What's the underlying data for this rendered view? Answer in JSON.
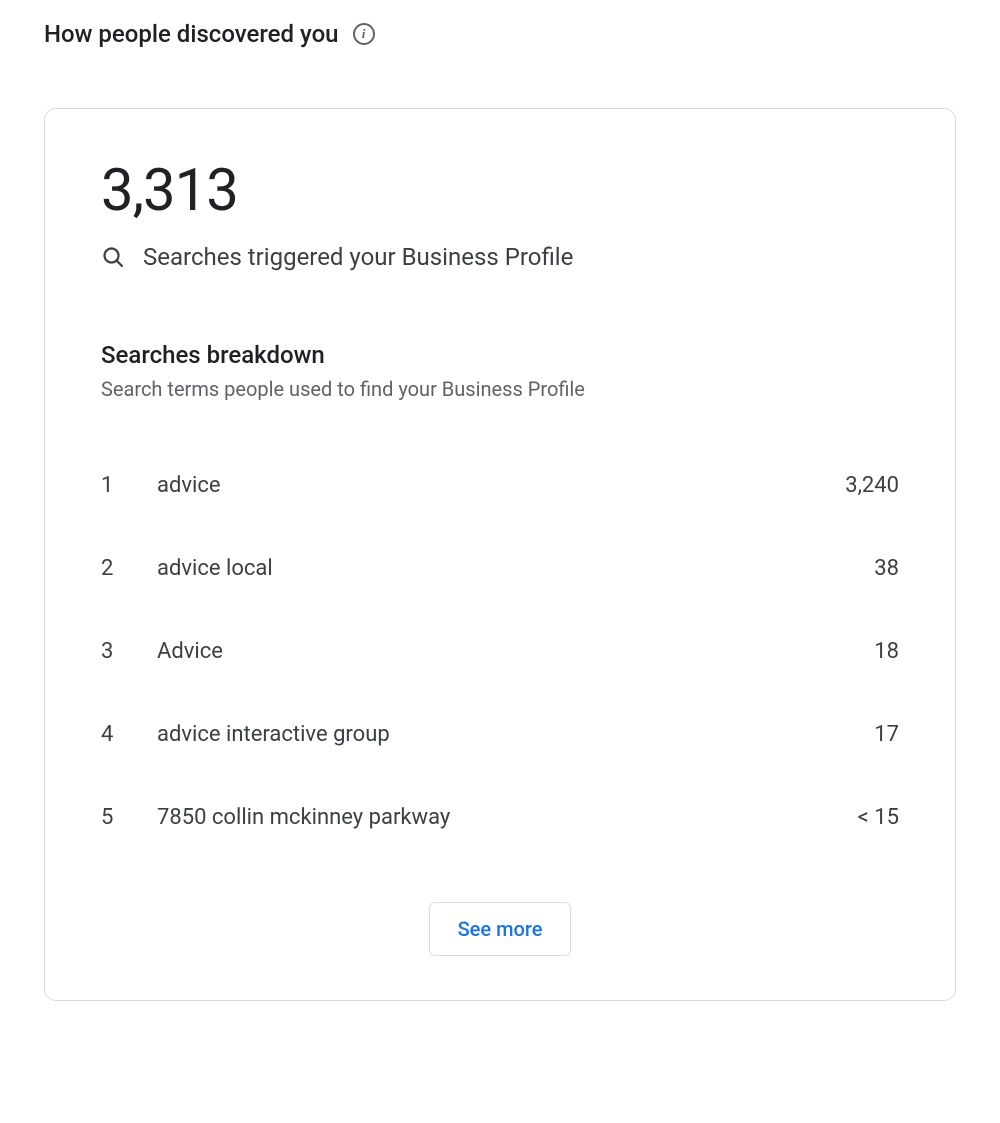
{
  "header": {
    "title": "How people discovered you"
  },
  "card": {
    "total": "3,313",
    "subtitle": "Searches triggered your Business Profile",
    "breakdown_title": "Searches breakdown",
    "breakdown_subtitle": "Search terms people used to find your Business Profile",
    "terms": [
      {
        "rank": "1",
        "term": "advice",
        "count": "3,240"
      },
      {
        "rank": "2",
        "term": "advice local",
        "count": "38"
      },
      {
        "rank": "3",
        "term": "Advice",
        "count": "18"
      },
      {
        "rank": "4",
        "term": "advice interactive group",
        "count": "17"
      },
      {
        "rank": "5",
        "term": "7850 collin mckinney parkway",
        "count": "< 15"
      }
    ],
    "see_more_label": "See more"
  }
}
